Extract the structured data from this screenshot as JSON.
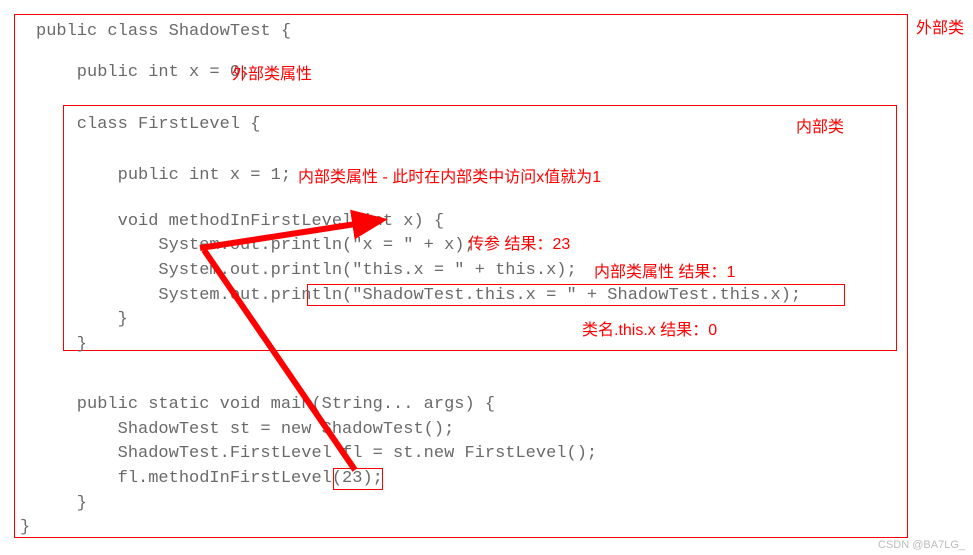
{
  "annotations": {
    "outer_class": "外部类",
    "outer_attr": "外部类属性",
    "inner_class": "内部类",
    "inner_attr": "内部类属性 - 此时在内部类中访问x值就为1",
    "pass_param": "传参 结果：23",
    "inner_attr_result": "内部类属性  结果：1",
    "classname_this": "类名.this.x 结果：0"
  },
  "code": {
    "l1": "public class ShadowTest {",
    "l2": "    public int x = 0;",
    "l3": "    class FirstLevel {",
    "l4": "        public int x = 1;",
    "l5": "        void methodInFirstLevel(int x) {",
    "l6": "            System.out.println(\"x = \" + x);",
    "l7": "            System.out.println(\"this.x = \" + this.x);",
    "l8": "            System.out.println(\"ShadowTest.this.x = \" + ShadowTest.this.x);",
    "l9": "        }",
    "l10": "    }",
    "l11": "    public static void main(String... args) {",
    "l12": "        ShadowTest st = new ShadowTest();",
    "l13": "        ShadowTest.FirstLevel fl = st.new FirstLevel();",
    "l14": "        fl.methodInFirstLevel(23);",
    "l15": "    }",
    "l16": "}"
  },
  "watermark": "CSDN @BA7LG_"
}
